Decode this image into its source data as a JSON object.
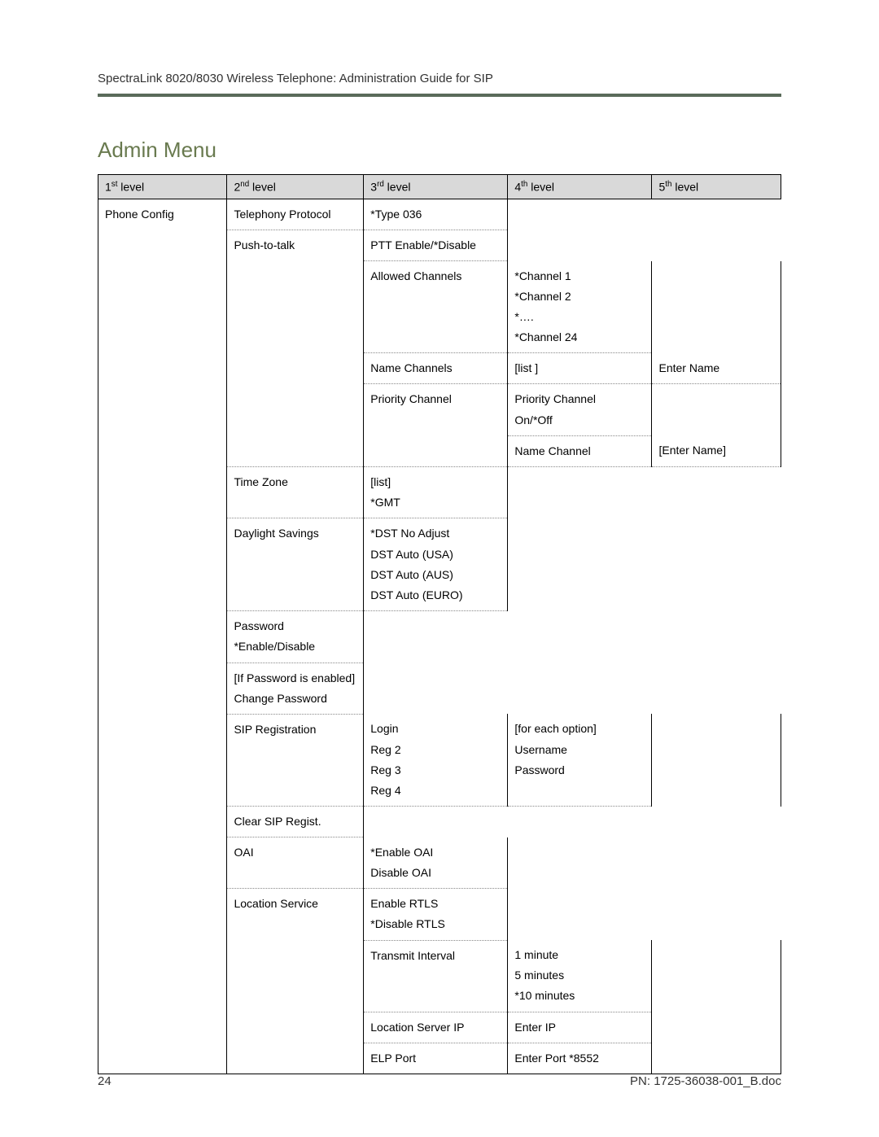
{
  "doc_header": "SpectraLink 8020/8030 Wireless Telephone: Administration Guide for SIP",
  "title": "Admin Menu",
  "headers": {
    "c1_pre": "1",
    "c1_sup": "st",
    "c1_post": " level",
    "c2_pre": "2",
    "c2_sup": "nd",
    "c2_post": " level",
    "c3_pre": "3",
    "c3_sup": "rd",
    "c3_post": " level",
    "c4_pre": "4",
    "c4_sup": "th",
    "c4_post": " level",
    "c5_pre": "5",
    "c5_sup": "th",
    "c5_post": " level"
  },
  "r1": {
    "c1": "Phone Config",
    "c2": "Telephony Protocol",
    "c3": "*Type 036"
  },
  "r2": {
    "c2": "Push-to-talk",
    "c3": "PTT Enable/*Disable"
  },
  "r3": {
    "c3": "Allowed Channels",
    "c4a": "*Channel 1",
    "c4b": "*Channel 2",
    "c4c": "*….",
    "c4d": "*Channel 24"
  },
  "r4": {
    "c3": "Name Channels",
    "c4": "[list ]",
    "c5": "Enter Name"
  },
  "r5": {
    "c3": "Priority Channel",
    "c4a": "Priority Channel",
    "c4b": "On/*Off"
  },
  "r6": {
    "c4": "Name Channel",
    "c5": "[Enter Name]"
  },
  "r7": {
    "c2": "Time Zone",
    "c3a": "[list]",
    "c3b": "*GMT"
  },
  "r8": {
    "c2": "Daylight Savings",
    "c3a": "*DST No Adjust",
    "c3b": "DST Auto (USA)",
    "c3c": "DST Auto (AUS)",
    "c3d": "DST Auto (EURO)"
  },
  "r9": {
    "c2a": "Password",
    "c2b": "*Enable/Disable"
  },
  "r10": {
    "c2a": "[If Password is enabled]",
    "c2b": "Change Password"
  },
  "r11": {
    "c2": "SIP Registration",
    "c3a": "Login",
    "c3b": "Reg 2",
    "c3c": "Reg 3",
    "c3d": "Reg 4",
    "c4a": "[for each option]",
    "c4b": "Username",
    "c4c": "Password"
  },
  "r12": {
    "c2": "Clear SIP Regist."
  },
  "r13": {
    "c2": "OAI",
    "c3a": "*Enable OAI",
    "c3b": "Disable OAI"
  },
  "r14": {
    "c2": "Location Service",
    "c3a": "Enable RTLS",
    "c3b": "*Disable RTLS"
  },
  "r15": {
    "c3": "Transmit Interval",
    "c4a": "1 minute",
    "c4b": "5 minutes",
    "c4c": "*10 minutes"
  },
  "r16": {
    "c3": "Location Server IP",
    "c4": "Enter IP"
  },
  "r17": {
    "c3": "ELP Port",
    "c4": "Enter Port  *8552"
  },
  "footer_left": "24",
  "footer_right": "PN: 1725-36038-001_B.doc"
}
